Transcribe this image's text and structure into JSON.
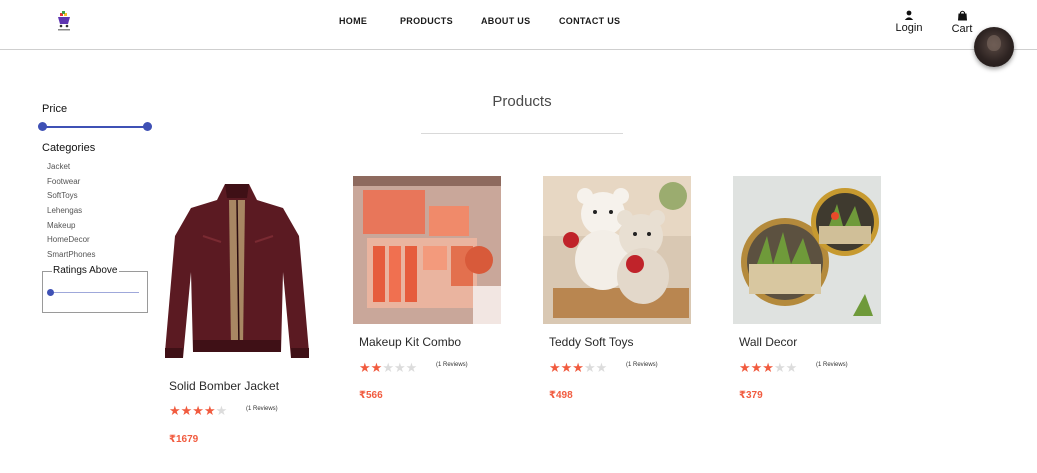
{
  "header": {
    "nav": [
      "HOME",
      "PRODUCTS",
      "ABOUT US",
      "CONTACT US"
    ],
    "login_label": "Login",
    "cart_label": "Cart",
    "login_icon": "person-icon",
    "cart_icon": "shopping-bag-icon"
  },
  "filters": {
    "price_label": "Price",
    "categories_label": "Categories",
    "categories": [
      "Jacket",
      "Footwear",
      "SoftToys",
      "Lehengas",
      "Makeup",
      "HomeDecor",
      "SmartPhones"
    ],
    "ratings_label": "Ratings Above",
    "accent_color": "#3f51b5"
  },
  "main": {
    "heading": "Products",
    "products": [
      {
        "name": "Solid Bomber Jacket",
        "rating": 4,
        "reviews": "(1 Reviews)",
        "price": "₹1679"
      },
      {
        "name": "Makeup Kit Combo",
        "rating": 2,
        "reviews": "(1 Reviews)",
        "price": "₹566"
      },
      {
        "name": "Teddy Soft Toys",
        "rating": 3,
        "reviews": "(1 Reviews)",
        "price": "₹498"
      },
      {
        "name": "Wall Decor",
        "rating": 3,
        "reviews": "(1 Reviews)",
        "price": "₹379"
      }
    ],
    "star_color": "#f15b3f"
  }
}
